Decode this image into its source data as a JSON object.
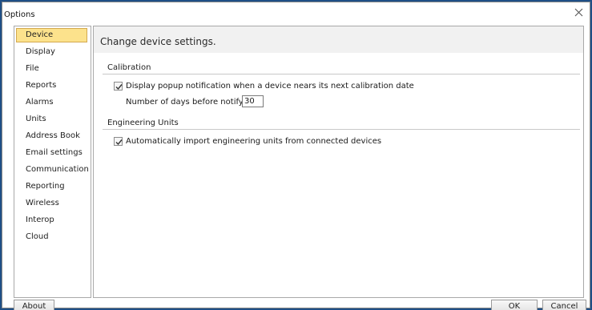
{
  "window": {
    "title": "Options",
    "close_icon": "close-icon"
  },
  "sidebar": {
    "items": [
      {
        "label": "Device",
        "selected": true
      },
      {
        "label": "Display",
        "selected": false
      },
      {
        "label": "File",
        "selected": false
      },
      {
        "label": "Reports",
        "selected": false
      },
      {
        "label": "Alarms",
        "selected": false
      },
      {
        "label": "Units",
        "selected": false
      },
      {
        "label": "Address Book",
        "selected": false
      },
      {
        "label": "Email settings",
        "selected": false
      },
      {
        "label": "Communication",
        "selected": false
      },
      {
        "label": "Reporting",
        "selected": false
      },
      {
        "label": "Wireless",
        "selected": false
      },
      {
        "label": "Interop",
        "selected": false
      },
      {
        "label": "Cloud",
        "selected": false
      }
    ]
  },
  "main": {
    "title": "Change device settings.",
    "calibration": {
      "header": "Calibration",
      "popup_label": "Display popup notification when a device nears its next calibration date",
      "popup_checked": true,
      "days_label": "Number of days before notifying:",
      "days_value": "30"
    },
    "engineering": {
      "header": "Engineering Units",
      "auto_import_label": "Automatically import engineering units from connected devices",
      "auto_import_checked": true
    }
  },
  "footer": {
    "about_label": "About",
    "ok_label": "OK",
    "cancel_label": "Cancel"
  },
  "colors": {
    "selection_bg": "#fce28c",
    "selection_border": "#d3a94f",
    "frame": "#1f4f86"
  }
}
